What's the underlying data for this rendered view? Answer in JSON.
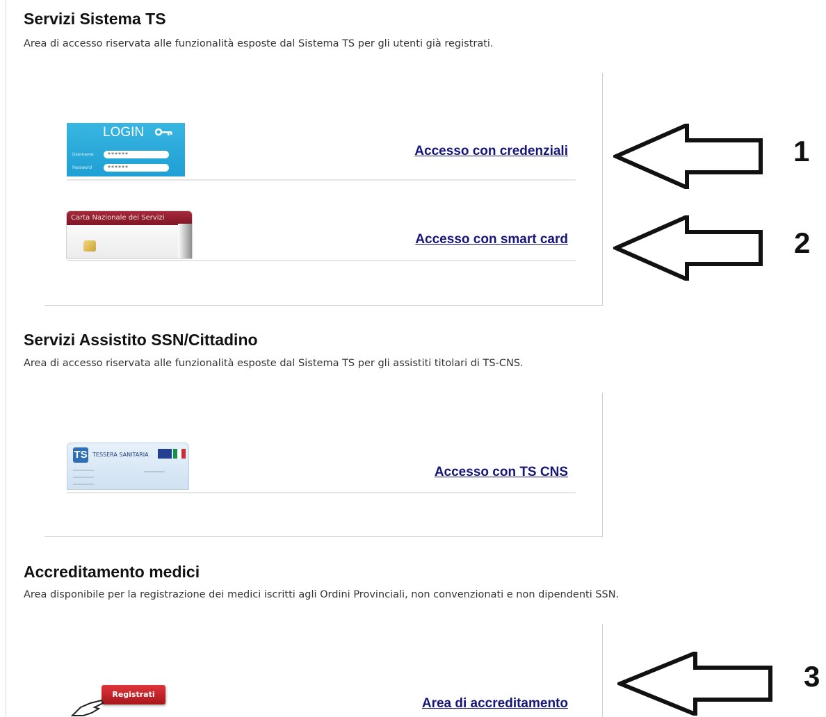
{
  "sections": [
    {
      "title": "Servizi Sistema TS",
      "description": "Area di accesso riservata alle funzionalità esposte dal Sistema TS per gli utenti già registrati.",
      "items": [
        {
          "link": "Accesso con credenziali",
          "image": "login-card-image"
        },
        {
          "link": "Accesso con smart card",
          "image": "carta-nazionale-servizi-image"
        }
      ]
    },
    {
      "title": "Servizi Assistito SSN/Cittadino",
      "description": "Area di accesso riservata alle funzionalità esposte dal Sistema TS per gli assistiti titolari di TS-CNS.",
      "items": [
        {
          "link": "Accesso con TS CNS",
          "image": "tessera-sanitaria-image"
        }
      ]
    },
    {
      "title": "Accreditamento medici",
      "description": "Area disponibile per la registrazione dei medici iscritti agli Ordini Provinciali, non convenzionati e non dipendenti SSN.",
      "items": [
        {
          "link": "Area di accreditamento",
          "image": "registrati-button-image"
        }
      ]
    }
  ],
  "login_card": {
    "heading": "LOGIN",
    "username_label": "Username",
    "password_label": "Password",
    "username_mask": "******",
    "password_mask": "******"
  },
  "cns_card": {
    "heading": "Carta Nazionale dei Servizi"
  },
  "ts_card": {
    "heading": "TESSERA SANITARIA",
    "badge": "TS"
  },
  "registrati_label": "Registrati",
  "annotations": [
    {
      "number": "1",
      "icon": "arrow-left-icon"
    },
    {
      "number": "2",
      "icon": "arrow-left-icon"
    },
    {
      "number": "3",
      "icon": "arrow-left-icon"
    }
  ],
  "colors": {
    "link": "#15157a",
    "login_card": "#1f9fd3",
    "cns_bar": "#8a1d2e",
    "registrati": "#c8242a"
  }
}
